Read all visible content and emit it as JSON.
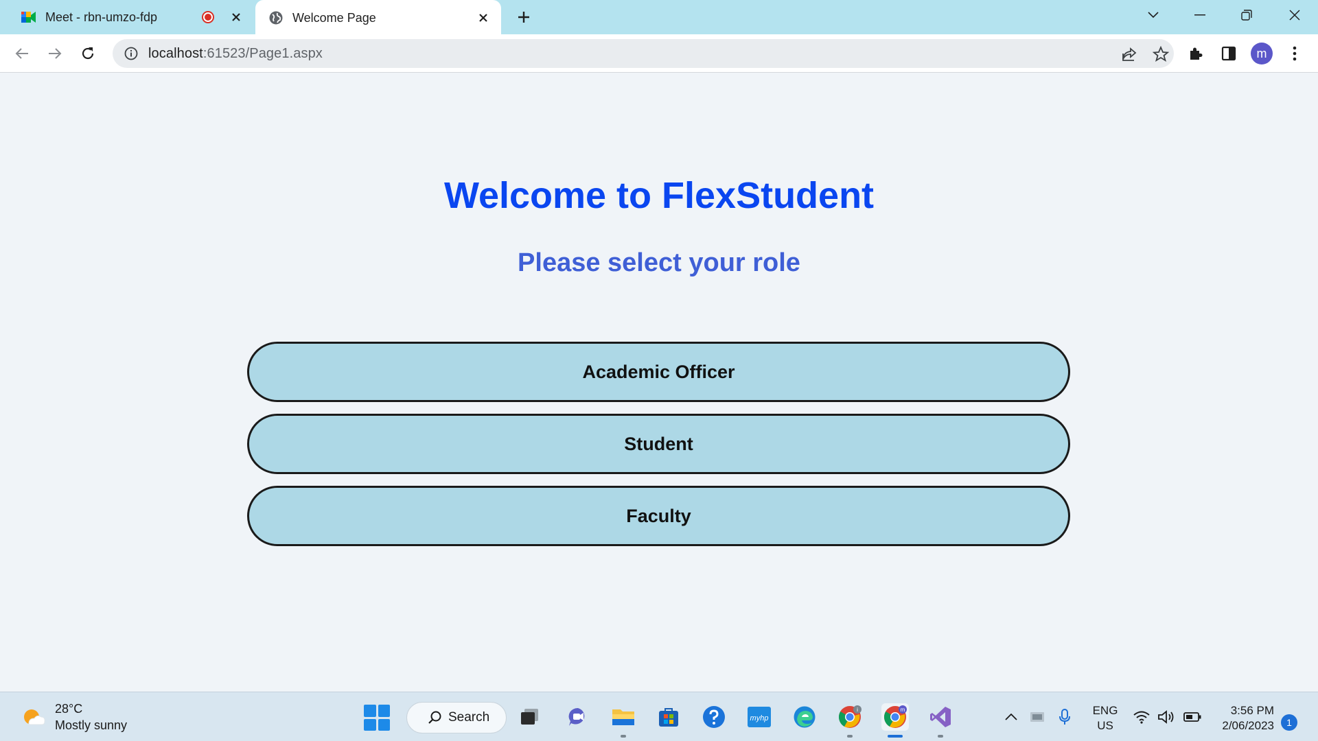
{
  "browser": {
    "tabs": [
      {
        "title": "Meet - rbn-umzo-fdp",
        "active": false
      },
      {
        "title": "Welcome Page",
        "active": true
      }
    ],
    "url_host": "localhost",
    "url_path": ":61523/Page1.aspx",
    "profile_initial": "m"
  },
  "page": {
    "title": "Welcome to FlexStudent",
    "subtitle": "Please select your role",
    "roles": [
      {
        "label": "Academic Officer"
      },
      {
        "label": "Student"
      },
      {
        "label": "Faculty"
      }
    ]
  },
  "taskbar": {
    "weather_temp": "28°C",
    "weather_desc": "Mostly sunny",
    "search_label": "Search",
    "lang_line1": "ENG",
    "lang_line2": "US",
    "time": "3:56 PM",
    "date": "2/06/2023",
    "notification_count": "1"
  },
  "colors": {
    "tabstrip": "#b4e3ef",
    "title_blue": "#0a46f0",
    "subtitle_blue": "#3f5fd6",
    "role_button_fill": "#add8e6",
    "page_bg": "#f0f4f8"
  }
}
